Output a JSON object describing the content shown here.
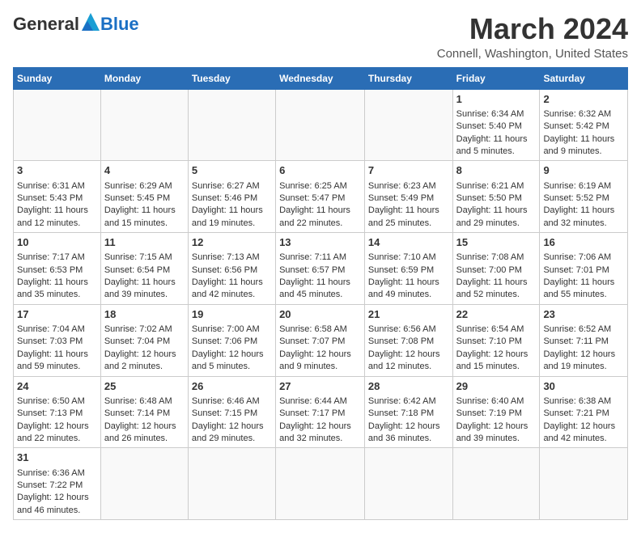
{
  "header": {
    "logo_general": "General",
    "logo_blue": "Blue",
    "month": "March 2024",
    "location": "Connell, Washington, United States"
  },
  "weekdays": [
    "Sunday",
    "Monday",
    "Tuesday",
    "Wednesday",
    "Thursday",
    "Friday",
    "Saturday"
  ],
  "weeks": [
    [
      {
        "day": "",
        "content": ""
      },
      {
        "day": "",
        "content": ""
      },
      {
        "day": "",
        "content": ""
      },
      {
        "day": "",
        "content": ""
      },
      {
        "day": "",
        "content": ""
      },
      {
        "day": "1",
        "content": "Sunrise: 6:34 AM\nSunset: 5:40 PM\nDaylight: 11 hours and 5 minutes."
      },
      {
        "day": "2",
        "content": "Sunrise: 6:32 AM\nSunset: 5:42 PM\nDaylight: 11 hours and 9 minutes."
      }
    ],
    [
      {
        "day": "3",
        "content": "Sunrise: 6:31 AM\nSunset: 5:43 PM\nDaylight: 11 hours and 12 minutes."
      },
      {
        "day": "4",
        "content": "Sunrise: 6:29 AM\nSunset: 5:45 PM\nDaylight: 11 hours and 15 minutes."
      },
      {
        "day": "5",
        "content": "Sunrise: 6:27 AM\nSunset: 5:46 PM\nDaylight: 11 hours and 19 minutes."
      },
      {
        "day": "6",
        "content": "Sunrise: 6:25 AM\nSunset: 5:47 PM\nDaylight: 11 hours and 22 minutes."
      },
      {
        "day": "7",
        "content": "Sunrise: 6:23 AM\nSunset: 5:49 PM\nDaylight: 11 hours and 25 minutes."
      },
      {
        "day": "8",
        "content": "Sunrise: 6:21 AM\nSunset: 5:50 PM\nDaylight: 11 hours and 29 minutes."
      },
      {
        "day": "9",
        "content": "Sunrise: 6:19 AM\nSunset: 5:52 PM\nDaylight: 11 hours and 32 minutes."
      }
    ],
    [
      {
        "day": "10",
        "content": "Sunrise: 7:17 AM\nSunset: 6:53 PM\nDaylight: 11 hours and 35 minutes."
      },
      {
        "day": "11",
        "content": "Sunrise: 7:15 AM\nSunset: 6:54 PM\nDaylight: 11 hours and 39 minutes."
      },
      {
        "day": "12",
        "content": "Sunrise: 7:13 AM\nSunset: 6:56 PM\nDaylight: 11 hours and 42 minutes."
      },
      {
        "day": "13",
        "content": "Sunrise: 7:11 AM\nSunset: 6:57 PM\nDaylight: 11 hours and 45 minutes."
      },
      {
        "day": "14",
        "content": "Sunrise: 7:10 AM\nSunset: 6:59 PM\nDaylight: 11 hours and 49 minutes."
      },
      {
        "day": "15",
        "content": "Sunrise: 7:08 AM\nSunset: 7:00 PM\nDaylight: 11 hours and 52 minutes."
      },
      {
        "day": "16",
        "content": "Sunrise: 7:06 AM\nSunset: 7:01 PM\nDaylight: 11 hours and 55 minutes."
      }
    ],
    [
      {
        "day": "17",
        "content": "Sunrise: 7:04 AM\nSunset: 7:03 PM\nDaylight: 11 hours and 59 minutes."
      },
      {
        "day": "18",
        "content": "Sunrise: 7:02 AM\nSunset: 7:04 PM\nDaylight: 12 hours and 2 minutes."
      },
      {
        "day": "19",
        "content": "Sunrise: 7:00 AM\nSunset: 7:06 PM\nDaylight: 12 hours and 5 minutes."
      },
      {
        "day": "20",
        "content": "Sunrise: 6:58 AM\nSunset: 7:07 PM\nDaylight: 12 hours and 9 minutes."
      },
      {
        "day": "21",
        "content": "Sunrise: 6:56 AM\nSunset: 7:08 PM\nDaylight: 12 hours and 12 minutes."
      },
      {
        "day": "22",
        "content": "Sunrise: 6:54 AM\nSunset: 7:10 PM\nDaylight: 12 hours and 15 minutes."
      },
      {
        "day": "23",
        "content": "Sunrise: 6:52 AM\nSunset: 7:11 PM\nDaylight: 12 hours and 19 minutes."
      }
    ],
    [
      {
        "day": "24",
        "content": "Sunrise: 6:50 AM\nSunset: 7:13 PM\nDaylight: 12 hours and 22 minutes."
      },
      {
        "day": "25",
        "content": "Sunrise: 6:48 AM\nSunset: 7:14 PM\nDaylight: 12 hours and 26 minutes."
      },
      {
        "day": "26",
        "content": "Sunrise: 6:46 AM\nSunset: 7:15 PM\nDaylight: 12 hours and 29 minutes."
      },
      {
        "day": "27",
        "content": "Sunrise: 6:44 AM\nSunset: 7:17 PM\nDaylight: 12 hours and 32 minutes."
      },
      {
        "day": "28",
        "content": "Sunrise: 6:42 AM\nSunset: 7:18 PM\nDaylight: 12 hours and 36 minutes."
      },
      {
        "day": "29",
        "content": "Sunrise: 6:40 AM\nSunset: 7:19 PM\nDaylight: 12 hours and 39 minutes."
      },
      {
        "day": "30",
        "content": "Sunrise: 6:38 AM\nSunset: 7:21 PM\nDaylight: 12 hours and 42 minutes."
      }
    ],
    [
      {
        "day": "31",
        "content": "Sunrise: 6:36 AM\nSunset: 7:22 PM\nDaylight: 12 hours and 46 minutes."
      },
      {
        "day": "",
        "content": ""
      },
      {
        "day": "",
        "content": ""
      },
      {
        "day": "",
        "content": ""
      },
      {
        "day": "",
        "content": ""
      },
      {
        "day": "",
        "content": ""
      },
      {
        "day": "",
        "content": ""
      }
    ]
  ]
}
